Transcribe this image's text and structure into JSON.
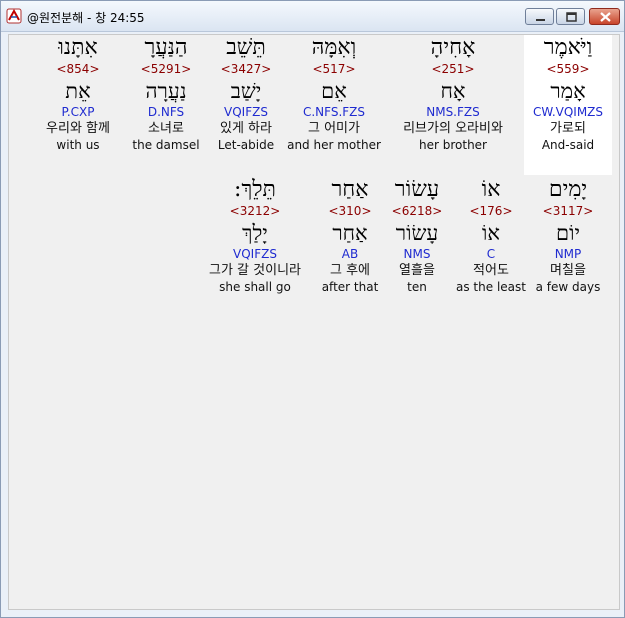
{
  "window": {
    "title": "@원전분해 - 창 24:55"
  },
  "icons": {
    "app": "app-logo-icon",
    "minimize": "minimize-icon",
    "maximize": "maximize-icon",
    "close": "close-icon"
  },
  "words": [
    {
      "hebrew": "וַיֹּאמֶר",
      "strong": "<559>",
      "lemma": "אָמַר",
      "parse": "CW.VQIMZS",
      "korean": "가로되",
      "english": "And-said"
    },
    {
      "hebrew": "אָחִיהָ",
      "strong": "<251>",
      "lemma": "אָח",
      "parse": "NMS.FZS",
      "korean": "리브가의 오라비와",
      "english": "her brother"
    },
    {
      "hebrew": "וְאִמָּהּ",
      "strong": "<517>",
      "lemma": "אֵם",
      "parse": "C.NFS.FZS",
      "korean": "그 어미가",
      "english": "and her mother"
    },
    {
      "hebrew": "תֵּשֵׁב",
      "strong": "<3427>",
      "lemma": "יָשַׁב",
      "parse": "VQIFZS",
      "korean": "있게 하라",
      "english": "Let-abide"
    },
    {
      "hebrew": "הַנַּעֲרָ",
      "strong": "<5291>",
      "lemma": "נַעֲרָה",
      "parse": "D.NFS",
      "korean": "소녀로",
      "english": "the damsel"
    },
    {
      "hebrew": "אִתָּנוּ",
      "strong": "<854>",
      "lemma": "אֵת",
      "parse": "P.CXP",
      "korean": "우리와 함께",
      "english": "with us"
    },
    {
      "hebrew": "יָמִים",
      "strong": "<3117>",
      "lemma": "יוֹם",
      "parse": "NMP",
      "korean": "며칠을",
      "english": "a few days"
    },
    {
      "hebrew": "אוֹ",
      "strong": "<176>",
      "lemma": "אוֹ",
      "parse": "C",
      "korean": "적어도",
      "english": "as the least"
    },
    {
      "hebrew": "עָשׂוֹר",
      "strong": "<6218>",
      "lemma": "עָשׂוֹר",
      "parse": "NMS",
      "korean": "열흘을",
      "english": "ten"
    },
    {
      "hebrew": "אַחַר",
      "strong": "<310>",
      "lemma": "אַחַר",
      "parse": "AB",
      "korean": "그 후에",
      "english": "after that"
    },
    {
      "hebrew": "תֵּלֵךְ:",
      "strong": "<3212>",
      "lemma": "יָלַךְ",
      "parse": "VQIFZS",
      "korean": "그가 갈 것이니라",
      "english": "she shall go"
    }
  ]
}
